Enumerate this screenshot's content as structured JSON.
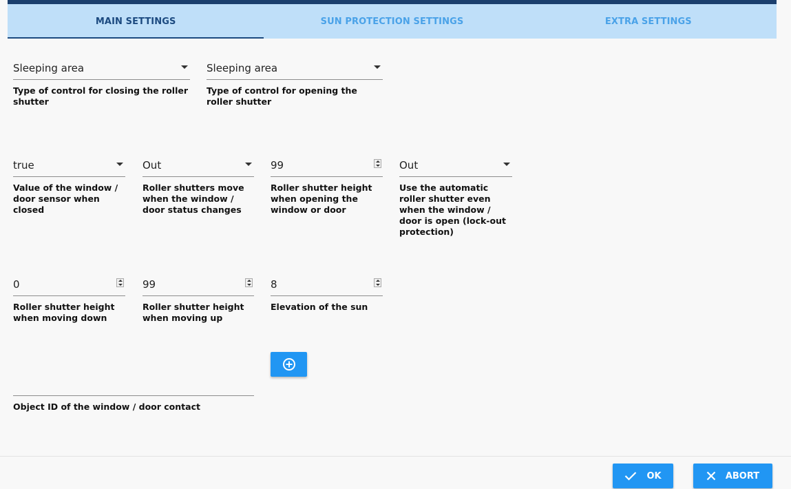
{
  "tabs": [
    {
      "label": "MAIN SETTINGS",
      "active": true
    },
    {
      "label": "SUN PROTECTION SETTINGS",
      "active": false
    },
    {
      "label": "EXTRA SETTINGS",
      "active": false
    }
  ],
  "fields": {
    "close_control": {
      "value": "Sleeping area",
      "label": "Type of control for closing the roller shutter"
    },
    "open_control": {
      "value": "Sleeping area",
      "label": "Type of control for opening the roller shutter"
    },
    "sensor_closed": {
      "value": "true",
      "label": "Value of the window / door sensor when closed"
    },
    "move_on_change": {
      "value": "Out",
      "label": "Roller shutters move when the window / door status changes"
    },
    "height_opening": {
      "value": "99",
      "label": "Roller shutter height when opening the window or door"
    },
    "lockout": {
      "value": "Out",
      "label": "Use the automatic roller shutter even when the window / door is open (lock-out protection)"
    },
    "height_down": {
      "value": "0",
      "label": "Roller shutter height when moving down"
    },
    "height_up": {
      "value": "99",
      "label": "Roller shutter height when moving up"
    },
    "sun_elevation": {
      "value": "8",
      "label": "Elevation of the sun"
    },
    "object_id": {
      "value": "",
      "label": "Object ID of the window / door contact"
    }
  },
  "buttons": {
    "ok": "OK",
    "abort": "ABORT"
  },
  "colors": {
    "accent": "#2196f3",
    "tab_bar": "#bfdff9",
    "active_tab": "#1c4a80",
    "top_bar": "#1b3f6e"
  },
  "icons": {
    "add": "add-circle-icon",
    "ok": "check-icon",
    "abort": "close-icon"
  }
}
